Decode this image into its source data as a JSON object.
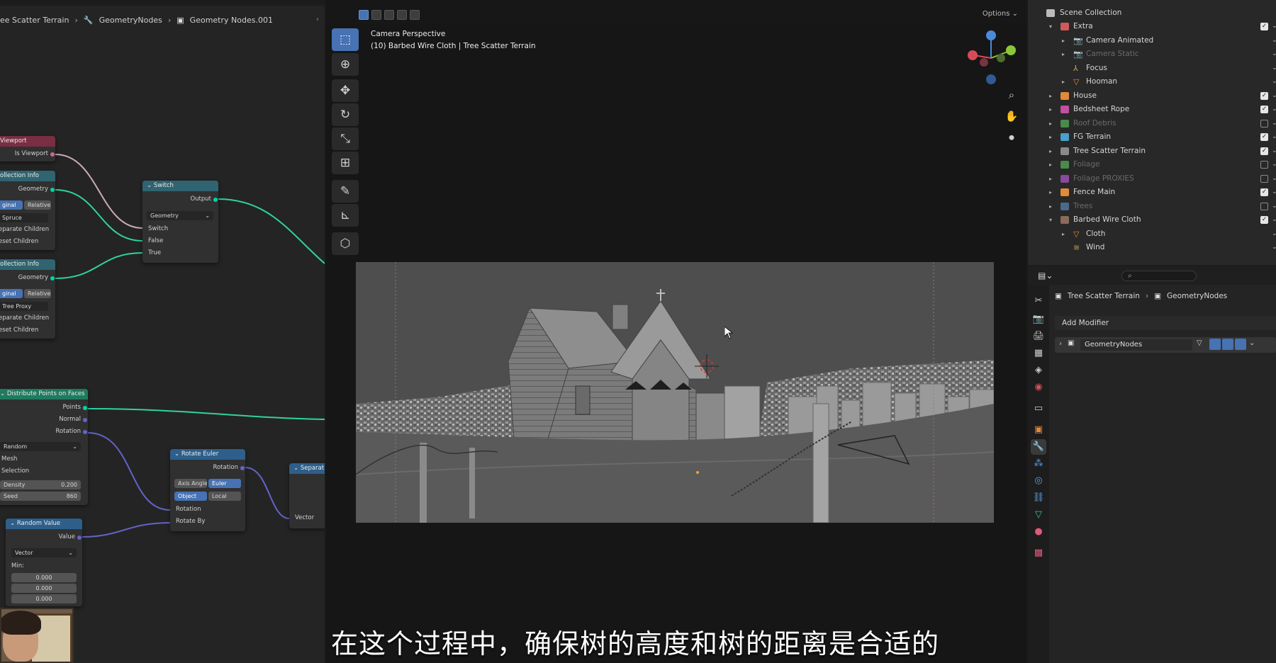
{
  "node_editor": {
    "breadcrumb": [
      "ee Scatter Terrain",
      "GeometryNodes",
      "Geometry Nodes.001"
    ],
    "nodes": {
      "viewport": {
        "title": "Viewport",
        "out": "Is Viewport"
      },
      "collection_info_1": {
        "title": "ollection Info",
        "out": "Geometry",
        "mode_a": "ginal",
        "mode_b": "Relative",
        "collection": "Spruce",
        "opt1": "eparate Children",
        "opt2": "eset Children"
      },
      "collection_info_2": {
        "title": "ollection Info",
        "out": "Geometry",
        "mode_a": "ginal",
        "mode_b": "Relative",
        "collection": "Tree Proxy",
        "opt1": "eparate Children",
        "opt2": "eset Children"
      },
      "switch": {
        "title": "Switch",
        "out": "Output",
        "type": "Geometry",
        "in1": "Switch",
        "in2": "False",
        "in3": "True"
      },
      "distribute": {
        "title": "Distribute Points on Faces",
        "out1": "Points",
        "out2": "Normal",
        "out3": "Rotation",
        "method": "Random",
        "in1": "Mesh",
        "in2": "Selection",
        "density_label": "Density",
        "density_value": "0.200",
        "seed_label": "Seed",
        "seed_value": "860"
      },
      "rotate_euler": {
        "title": "Rotate Euler",
        "out": "Rotation",
        "mode_a": "Axis Angle",
        "mode_b": "Euler",
        "space_a": "Object",
        "space_b": "Local",
        "in1": "Rotation",
        "in2": "Rotate By"
      },
      "separate": {
        "title": "Separat",
        "in": "Vector"
      },
      "random_value": {
        "title": "Random Value",
        "out": "Value",
        "type": "Vector",
        "min_label": "Min:",
        "min_values": [
          "0.000",
          "0.000",
          "0.000"
        ]
      }
    }
  },
  "viewport": {
    "options": "Options",
    "camera_title": "Camera Perspective",
    "camera_subtitle": "(10) Barbed Wire Cloth | Tree Scatter Terrain",
    "subtitle": "在这个过程中，确保树的高度和树的距离是合适的"
  },
  "outliner": {
    "root": "Scene Collection",
    "rows": [
      {
        "name": "Extra",
        "indent": 1,
        "arrow": "▾",
        "color": "#d05a5a",
        "checked": true,
        "disabled": false,
        "kind": "collection"
      },
      {
        "name": "Camera Animated",
        "indent": 2,
        "arrow": "▸",
        "color": "#7aa06a",
        "checked": null,
        "disabled": false,
        "kind": "camera"
      },
      {
        "name": "Camera Static",
        "indent": 2,
        "arrow": "▸",
        "color": "#5f7a55",
        "checked": null,
        "disabled": true,
        "kind": "camera"
      },
      {
        "name": "Focus",
        "indent": 2,
        "arrow": "",
        "color": "#e0a050",
        "checked": null,
        "disabled": false,
        "kind": "empty"
      },
      {
        "name": "Hooman",
        "indent": 2,
        "arrow": "▸",
        "color": "#e08a3a",
        "checked": null,
        "disabled": false,
        "kind": "mesh"
      },
      {
        "name": "House",
        "indent": 1,
        "arrow": "▸",
        "color": "#e08a3a",
        "checked": true,
        "disabled": false,
        "kind": "collection"
      },
      {
        "name": "Bedsheet Rope",
        "indent": 1,
        "arrow": "▸",
        "color": "#c24fa0",
        "checked": true,
        "disabled": false,
        "kind": "collection"
      },
      {
        "name": "Roof Debris",
        "indent": 1,
        "arrow": "▸",
        "color": "#4a8a4a",
        "checked": false,
        "disabled": true,
        "kind": "collection"
      },
      {
        "name": "FG Terrain",
        "indent": 1,
        "arrow": "▸",
        "color": "#4aa0c8",
        "checked": true,
        "disabled": false,
        "kind": "collection"
      },
      {
        "name": "Tree Scatter Terrain",
        "indent": 1,
        "arrow": "▸",
        "color": "#8a8a8a",
        "checked": true,
        "disabled": false,
        "kind": "collection"
      },
      {
        "name": "Foliage",
        "indent": 1,
        "arrow": "▸",
        "color": "#4a8a4a",
        "checked": false,
        "disabled": true,
        "kind": "collection"
      },
      {
        "name": "Foliage PROXIES",
        "indent": 1,
        "arrow": "▸",
        "color": "#8a4a9a",
        "checked": false,
        "disabled": true,
        "kind": "collection"
      },
      {
        "name": "Fence Main",
        "indent": 1,
        "arrow": "▸",
        "color": "#e08a3a",
        "checked": true,
        "disabled": false,
        "kind": "collection"
      },
      {
        "name": "Trees",
        "indent": 1,
        "arrow": "▸",
        "color": "#4a6a8a",
        "checked": false,
        "disabled": true,
        "kind": "collection"
      },
      {
        "name": "Barbed Wire Cloth",
        "indent": 1,
        "arrow": "▾",
        "color": "#8a6a5a",
        "checked": true,
        "disabled": false,
        "kind": "collection"
      },
      {
        "name": "Cloth",
        "indent": 2,
        "arrow": "▸",
        "color": "#e08a3a",
        "checked": null,
        "disabled": false,
        "kind": "mesh"
      },
      {
        "name": "Wind",
        "indent": 2,
        "arrow": "",
        "color": "#c8a050",
        "checked": null,
        "disabled": false,
        "kind": "force"
      }
    ]
  },
  "properties": {
    "breadcrumb_object": "Tree Scatter Terrain",
    "breadcrumb_modifier": "GeometryNodes",
    "add_modifier": "Add Modifier",
    "modifier_name": "GeometryNodes"
  },
  "colors": {
    "accent": "#4772b3",
    "socket_geometry": "#00d6a3",
    "socket_vector": "#6363c7"
  }
}
